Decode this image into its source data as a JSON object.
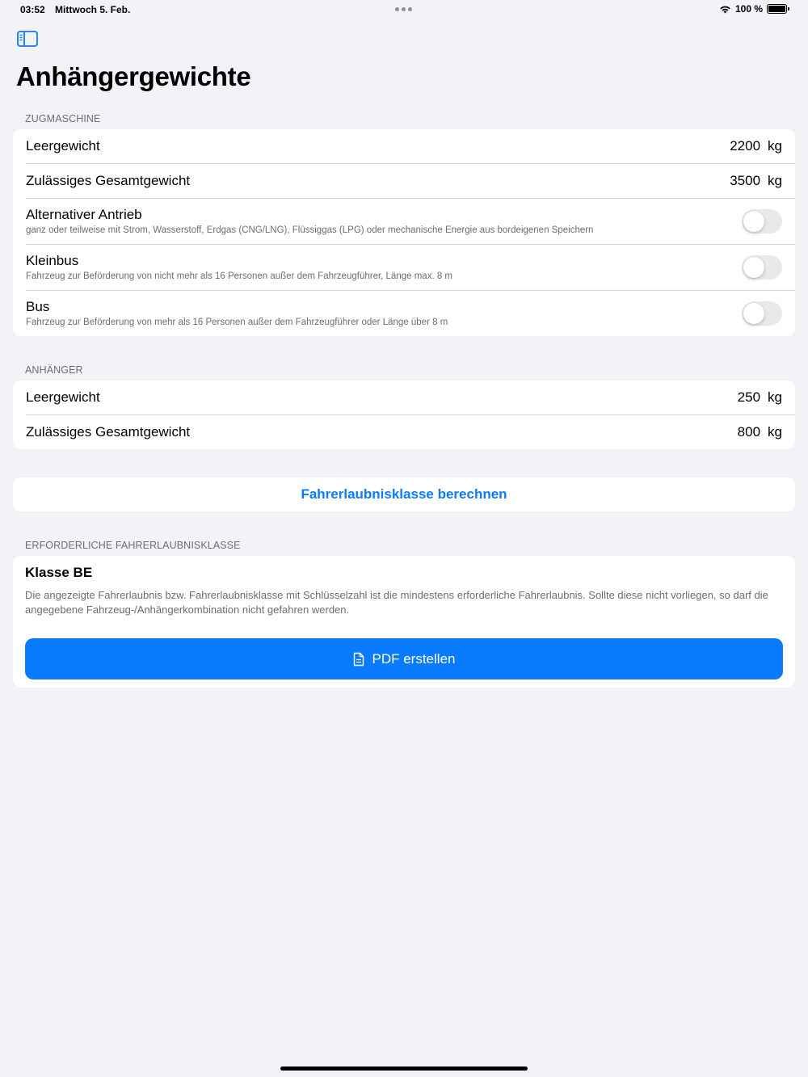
{
  "status_bar": {
    "time": "03:52",
    "date": "Mittwoch 5. Feb.",
    "battery": "100 %"
  },
  "page": {
    "title": "Anhängergewichte"
  },
  "zugmaschine": {
    "header": "ZUGMASCHINE",
    "leergewicht": {
      "label": "Leergewicht",
      "value": "2200",
      "unit": "kg"
    },
    "gesamtgewicht": {
      "label": "Zulässiges Gesamtgewicht",
      "value": "3500",
      "unit": "kg"
    },
    "toggles": [
      {
        "label": "Alternativer Antrieb",
        "subtitle": "ganz oder teilweise mit Strom, Wasserstoff, Erdgas (CNG/LNG), Flüssiggas (LPG) oder mechanische Energie aus bordeigenen Speichern",
        "on": false
      },
      {
        "label": "Kleinbus",
        "subtitle": "Fahrzeug zur Beförderung von nicht mehr als 16 Personen außer dem Fahrzeugführer, Länge max. 8 m",
        "on": false
      },
      {
        "label": "Bus",
        "subtitle": "Fahrzeug zur Beförderung von mehr als 16 Personen außer dem Fahrzeugführer oder Länge über 8 m",
        "on": false
      }
    ]
  },
  "anhaenger": {
    "header": "ANHÄNGER",
    "leergewicht": {
      "label": "Leergewicht",
      "value": "250",
      "unit": "kg"
    },
    "gesamtgewicht": {
      "label": "Zulässiges Gesamtgewicht",
      "value": "800",
      "unit": "kg"
    }
  },
  "calculate": {
    "label": "Fahrerlaubnisklasse berechnen"
  },
  "result": {
    "header": "ERFORDERLICHE FAHRERLAUBNISKLASSE",
    "title": "Klasse BE",
    "description": "Die angezeigte Fahrerlaubnis bzw. Fahrerlaubnisklasse mit Schlüsselzahl ist die mindestens erforderliche Fahrerlaubnis. Sollte diese nicht vorliegen, so darf die angegebene Fahrzeug-/Anhängerkombination nicht gefahren werden.",
    "pdf_button": "PDF erstellen"
  },
  "colors": {
    "accent": "#0a7aff",
    "background": "#f2f2f7",
    "secondary_text": "#6d6d72"
  },
  "icons": {
    "sidebar": "sidebar-toggle-icon",
    "pdf": "document-icon",
    "wifi": "wifi-icon",
    "battery": "battery-icon"
  }
}
